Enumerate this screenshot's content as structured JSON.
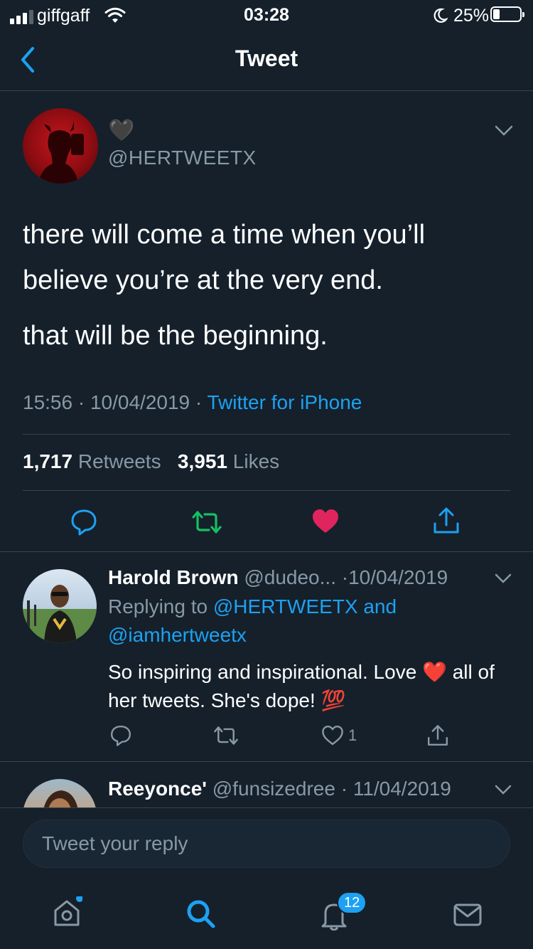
{
  "status_bar": {
    "carrier": "giffgaff",
    "time": "03:28",
    "battery_percent": "25%"
  },
  "nav": {
    "title": "Tweet",
    "back_icon": "chevron-left-icon"
  },
  "tweet": {
    "display_name_emoji": "🖤",
    "handle": "@HERTWEETX",
    "text_line1": "there will come a time when you’ll believe you’re at the very end.",
    "text_line2": "that will be the beginning.",
    "time": "15:56",
    "date": "10/04/2019",
    "source": "Twitter for iPhone",
    "retweets_count": "1,717",
    "retweets_label": "Retweets",
    "likes_count": "3,951",
    "likes_label": "Likes"
  },
  "replies": [
    {
      "name": "Harold Brown",
      "handle": "@dudeo...",
      "date": "10/04/2019",
      "replying_prefix": "Replying to",
      "replying_to_1": "@HERTWEETX",
      "replying_and": "and",
      "replying_to_2": "@iamhertweetx",
      "body_part1": "So inspiring and inspirational. Love",
      "body_emoji1": "❤️",
      "body_part2": "all of her tweets. She's dope!",
      "body_emoji2": "💯",
      "like_count": "1"
    },
    {
      "name": "Reeyonce'",
      "handle": "@funsizedree",
      "date": "11/04/2019"
    }
  ],
  "composer": {
    "placeholder": "Tweet your reply"
  },
  "tabbar": {
    "notifications_badge": "12"
  },
  "colors": {
    "background": "#15202b",
    "accent": "#1da1f2",
    "like": "#e0245e",
    "retweet": "#17bf63",
    "secondary_text": "#8899a6"
  }
}
